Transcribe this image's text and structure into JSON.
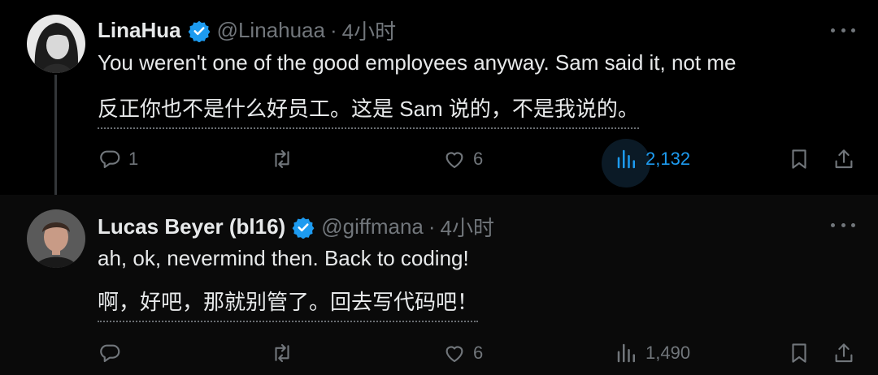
{
  "tweets": [
    {
      "name": "LinaHua",
      "handle": "@Linahuaa",
      "separator": "·",
      "time": "4小时",
      "text_en": "You weren't one of the good employees anyway. Sam said it, not me",
      "text_zh": "反正你也不是什么好员工。这是 Sam 说的，不是我说的。",
      "replies": "1",
      "retweets": "",
      "likes": "6",
      "views": "2,132"
    },
    {
      "name": "Lucas Beyer (bl16)",
      "handle": "@giffmana",
      "separator": "·",
      "time": "4小时",
      "text_en": "ah, ok, nevermind then. Back to coding!",
      "text_zh": "啊，好吧，那就别管了。回去写代码吧！",
      "replies": "",
      "retweets": "",
      "likes": "6",
      "views": "1,490"
    }
  ],
  "colors": {
    "background": "#000000",
    "text": "#e7e9ea",
    "secondary": "#71767b",
    "accent": "#1d9bf0"
  },
  "icons": [
    "verified-badge-icon",
    "more-icon",
    "reply-icon",
    "retweet-icon",
    "like-icon",
    "views-icon",
    "bookmark-icon",
    "share-icon"
  ]
}
